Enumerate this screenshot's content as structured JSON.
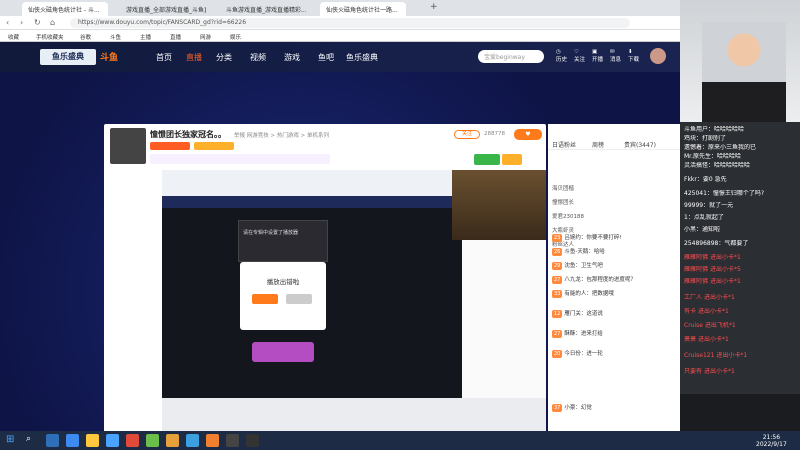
{
  "browser": {
    "tabs": [
      {
        "label": "仙侠火磁角色统计社 - 斗..."
      },
      {
        "label": "游戏直播_全部游戏直播_斗鱼直..."
      },
      {
        "label": "斗鱼游戏直播_游戏直播精彩..."
      },
      {
        "label": "仙侠火磁角色统计社一路..."
      }
    ],
    "url": "https://www.douyu.com/topic/FANSCARD_gd?rid=66226",
    "bookmarks": [
      "收藏",
      "手机收藏夹",
      "谷歌",
      "斗鱼",
      "主播",
      "直播",
      "网游",
      "娱乐"
    ]
  },
  "header": {
    "logo_text": "鱼乐盛典",
    "brand": "斗鱼",
    "nav": [
      "首页",
      "直播",
      "分类",
      "视频",
      "游戏",
      "鱼吧",
      "鱼乐盛典"
    ],
    "search_placeholder": "宝爱beginway",
    "user_links": [
      "历史",
      "关注",
      "开播",
      "消息",
      "下载"
    ]
  },
  "room": {
    "title": "憧憬团长独家冠名。。",
    "meta": "举报 网游竞技 > 热门游戏 > 单机系列",
    "follow_label": "关注",
    "follow_count": "288778"
  },
  "video": {
    "popup_text": "播放出错啦",
    "popup_hint": "请在专辑中设置了播放器"
  },
  "chat_panel": {
    "tabs": [
      "日语粉丝",
      "周榜",
      "贵宾(3447)"
    ],
    "ranks": [
      "海贝团楷",
      "憧憬团长",
      "爱君230188",
      "大瓶虾灵",
      "粉丝达人"
    ],
    "messages": [
      {
        "level": "23",
        "text": "吕婉约：你要不要打碎!"
      },
      {
        "level": "26",
        "text": "斗鱼-天鹅：哈哈"
      },
      {
        "level": "29",
        "text": "沈鱼：卫生气吧"
      },
      {
        "level": "27",
        "text": "八九龙：包那程度的进度呢？"
      },
      {
        "level": "33",
        "text": "有能的人：把数据哦"
      },
      {
        "level": "12",
        "text": "雁门关：这道说"
      },
      {
        "level": "27",
        "text": "酥酥：进来打给"
      },
      {
        "level": "20",
        "text": "今日份：进一轮"
      },
      {
        "level": "37",
        "text": "小豪：幻觉"
      }
    ]
  },
  "danmu": [
    {
      "user": "斗鱼用户",
      "text": "哈哈哈哈哈",
      "color": "#ffffff"
    },
    {
      "user": "鸡块",
      "text": "打剧别了",
      "color": "#ffffff"
    },
    {
      "user": "遗憾着",
      "text": "原来小三鱼我的已",
      "color": "#ffffff"
    },
    {
      "user": "Mr.原先生",
      "text": "哈哈哈哈",
      "color": "#ffffff"
    },
    {
      "user": "灵活搞怪",
      "text": "哈哈哈哈哈哈",
      "color": "#ffffff"
    },
    {
      "user": "Fkkr",
      "text": "要0 急先",
      "color": "#ffffff"
    },
    {
      "user": "425041",
      "text": "憧憬王归哪个了吗?",
      "color": "#ffffff"
    },
    {
      "user": "99999",
      "text": "就了一元",
      "color": "#ffffff"
    },
    {
      "user": "1",
      "text": "点乱就起了",
      "color": "#ffffff"
    },
    {
      "user": "小黑",
      "text": "通知啦",
      "color": "#ffffff"
    },
    {
      "user": "254896898",
      "text": "气都要了",
      "color": "#ffffff"
    },
    {
      "user": "雁雁阿佛",
      "text": "进出小卡*1",
      "color": "#ff4d4d"
    },
    {
      "user": "雁雁阿佛",
      "text": "进出小卡*5",
      "color": "#ff4d4d"
    },
    {
      "user": "雁雁阿佛",
      "text": "进出小卡*1",
      "color": "#ff4d4d"
    },
    {
      "user": "工厂人",
      "text": "进出小卡*1",
      "color": "#ff4d4d"
    },
    {
      "user": "有卡",
      "text": "进出小卡*1",
      "color": "#ff4d4d"
    },
    {
      "user": "Cruise",
      "text": "进出飞机*1",
      "color": "#ff4d4d"
    },
    {
      "user": "萧萧",
      "text": "进出小卡*1",
      "color": "#ff4d4d"
    },
    {
      "user": "Cruise121",
      "text": "进出小卡*1",
      "color": "#ff4d4d"
    },
    {
      "user": "只要有",
      "text": "进出小卡*1",
      "color": "#ff4d4d"
    }
  ],
  "taskbar": {
    "time": "21:56",
    "date": "2022/9/17"
  }
}
